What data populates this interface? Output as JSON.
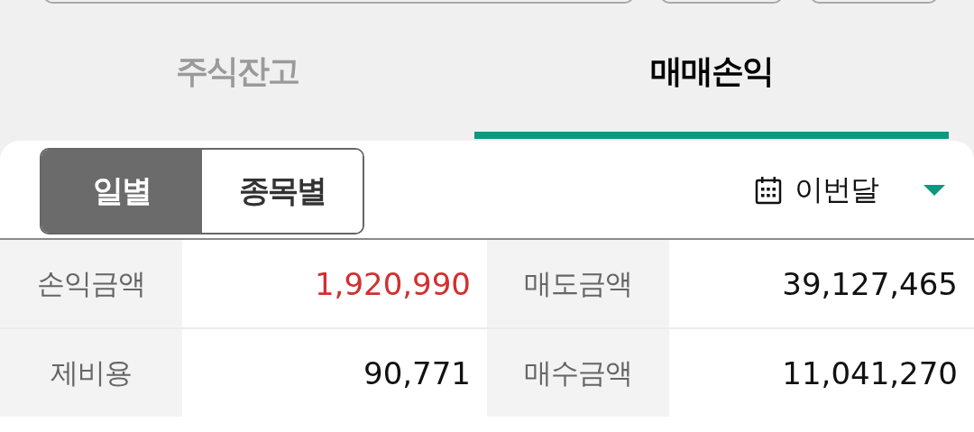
{
  "tabs": [
    {
      "label": "주식잔고",
      "selected": false
    },
    {
      "label": "매매손익",
      "selected": true
    }
  ],
  "view_toggle": [
    {
      "label": "일별",
      "selected": true
    },
    {
      "label": "종목별",
      "selected": false
    }
  ],
  "period_dropdown": {
    "value": "이번달"
  },
  "summary": [
    {
      "label": "손익금액",
      "value": "1,920,990",
      "color": "#d32f2f"
    },
    {
      "label": "매도금액",
      "value": "39,127,465",
      "color": "#111111"
    },
    {
      "label": "제비용",
      "value": "90,771",
      "color": "#111111"
    },
    {
      "label": "매수금액",
      "value": "11,041,270",
      "color": "#111111"
    }
  ]
}
